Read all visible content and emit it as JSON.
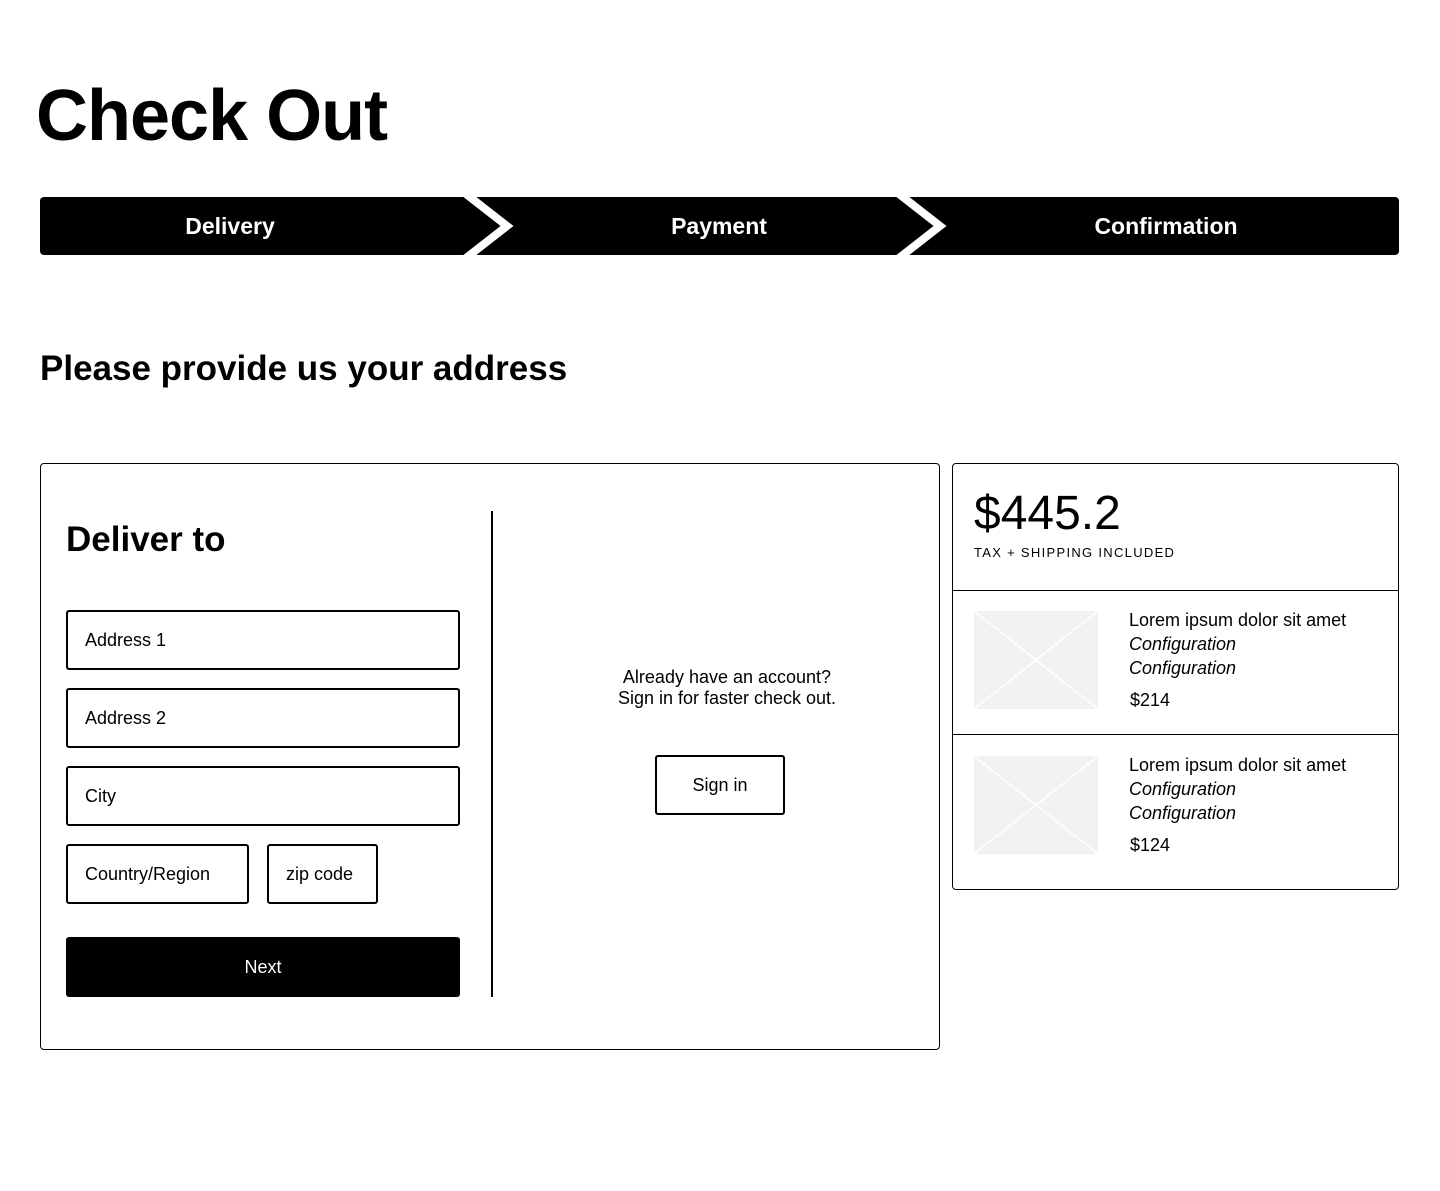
{
  "page": {
    "title": "Check Out",
    "subtitle": "Please provide us your address"
  },
  "steps": [
    {
      "label": "Delivery"
    },
    {
      "label": "Payment"
    },
    {
      "label": "Confirmation"
    }
  ],
  "delivery_form": {
    "heading": "Deliver to",
    "fields": {
      "address1": {
        "placeholder": "Address 1",
        "value": ""
      },
      "address2": {
        "placeholder": "Address 2",
        "value": ""
      },
      "city": {
        "placeholder": "City",
        "value": ""
      },
      "country": {
        "placeholder": "Country/Region",
        "value": ""
      },
      "zip": {
        "placeholder": "zip code",
        "value": ""
      }
    },
    "next_label": "Next"
  },
  "account": {
    "line1": "Already have an account?",
    "line2": "Sign in for faster check out.",
    "signin_label": "Sign in"
  },
  "summary": {
    "total": "$445.2",
    "total_note": "TAX + SHIPPING INCLUDED",
    "items": [
      {
        "title": "Lorem ipsum dolor sit amet",
        "config1": "Configuration",
        "config2": "Configuration",
        "price": "$214",
        "image_icon": "image-placeholder-icon"
      },
      {
        "title": "Lorem ipsum dolor sit amet",
        "config1": "Configuration",
        "config2": "Configuration",
        "price": "$124",
        "image_icon": "image-placeholder-icon"
      }
    ]
  },
  "colors": {
    "primary": "#000000",
    "background": "#ffffff",
    "placeholder_fill": "#f2f2f2"
  }
}
